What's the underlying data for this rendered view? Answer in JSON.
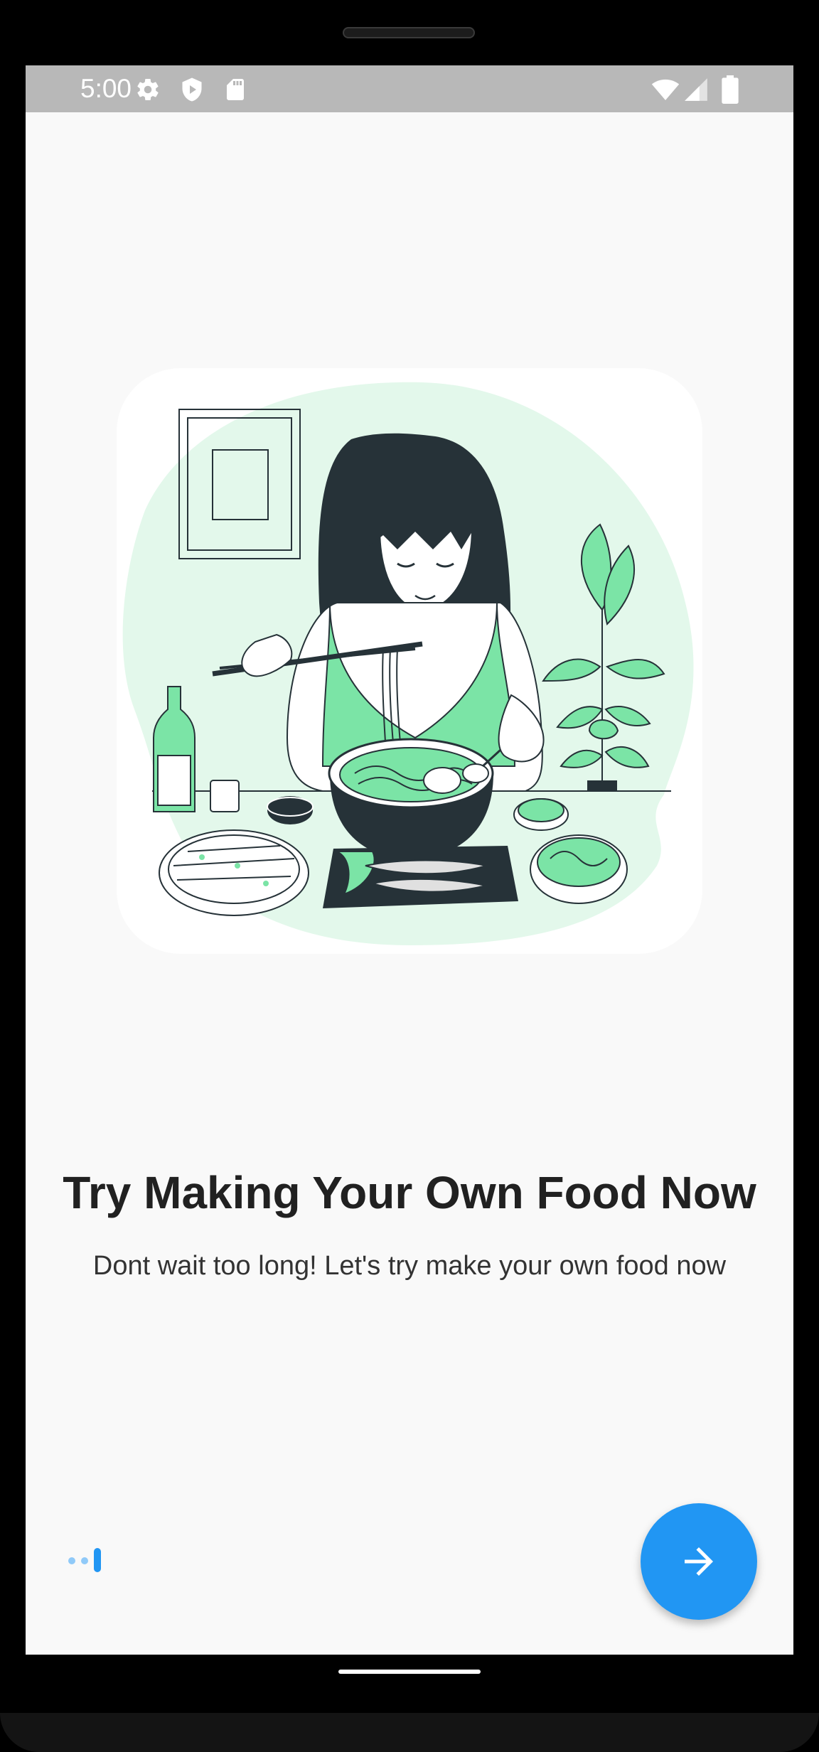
{
  "status_bar": {
    "time": "5:00",
    "left_icons": [
      "settings-icon",
      "shield-play-icon",
      "sd-card-icon"
    ],
    "right_icons": [
      "wifi-icon",
      "signal-icon",
      "battery-icon"
    ]
  },
  "onboarding": {
    "illustration": "woman-eating-noodles-illustration",
    "title": "Try Making Your Own Food Now",
    "subtitle": "Dont wait too long! Let's try make your own food now",
    "page_count": 3,
    "current_page": 3
  },
  "next_button": {
    "icon": "arrow-right-icon"
  },
  "colors": {
    "accent": "#2196f3",
    "accent_light": "#90caf9",
    "illustration_green": "#7be4a6",
    "illustration_bg": "#e3f8eb",
    "illustration_dark": "#263238",
    "status_bar": "#b8b8b8"
  }
}
